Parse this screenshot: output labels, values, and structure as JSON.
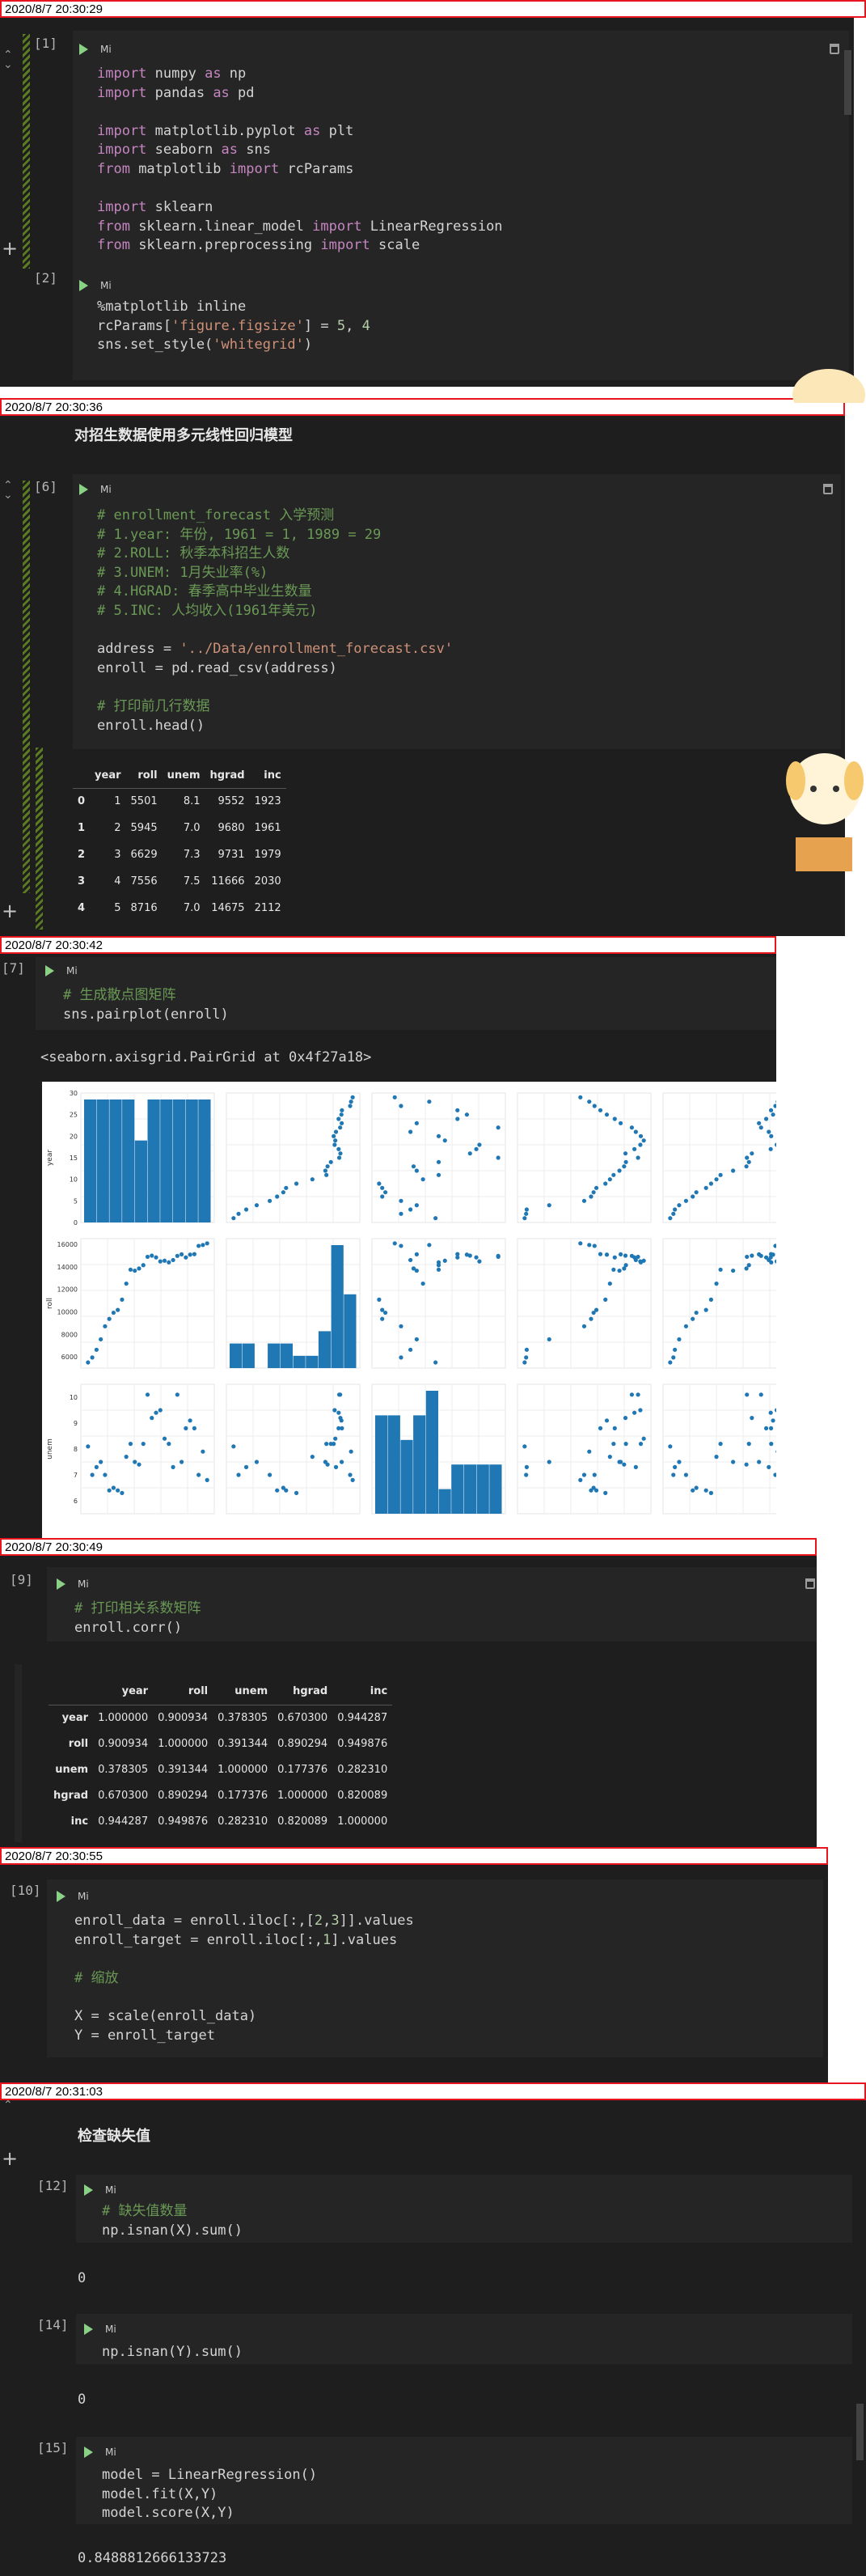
{
  "sections": [
    {
      "timestamp": "2020/8/7 20:30:29"
    },
    {
      "timestamp": "2020/8/7 20:30:36"
    },
    {
      "timestamp": "2020/8/7 20:30:42"
    },
    {
      "timestamp": "2020/8/7 20:30:49"
    },
    {
      "timestamp": "2020/8/7 20:30:55"
    },
    {
      "timestamp": "2020/8/7 20:31:03"
    }
  ],
  "run_label": "Mi",
  "cells": {
    "c1": {
      "num": "[1]",
      "lines": [
        "import numpy as np",
        "import pandas as pd",
        "",
        "import matplotlib.pyplot as plt",
        "import seaborn as sns",
        "from matplotlib import rcParams",
        "",
        "import sklearn",
        "from sklearn.linear_model import LinearRegression",
        "from sklearn.preprocessing import scale"
      ]
    },
    "c2": {
      "num": "[2]",
      "lines": [
        "%matplotlib inline",
        "rcParams['figure.figsize'] = 5, 4",
        "sns.set_style('whitegrid')"
      ]
    },
    "md1": "对招生数据使用多元线性回归模型",
    "c6": {
      "num": "[6]",
      "lines": [
        "# enrollment_forecast 入学预测",
        "# 1.year: 年份, 1961 = 1, 1989 = 29",
        "# 2.ROLL: 秋季本科招生人数",
        "# 3.UNEM: 1月失业率(%)",
        "# 4.HGRAD: 春季高中毕业生数量",
        "# 5.INC: 人均收入(1961年美元)",
        "",
        "address = '../Data/enrollment_forecast.csv'",
        "enroll = pd.read_csv(address)",
        "",
        "# 打印前几行数据",
        "enroll.head()"
      ]
    },
    "head_table": {
      "columns": [
        "",
        "year",
        "roll",
        "unem",
        "hgrad",
        "inc"
      ],
      "rows": [
        [
          "0",
          "1",
          "5501",
          "8.1",
          "9552",
          "1923"
        ],
        [
          "1",
          "2",
          "5945",
          "7.0",
          "9680",
          "1961"
        ],
        [
          "2",
          "3",
          "6629",
          "7.3",
          "9731",
          "1979"
        ],
        [
          "3",
          "4",
          "7556",
          "7.5",
          "11666",
          "2030"
        ],
        [
          "4",
          "5",
          "8716",
          "7.0",
          "14675",
          "2112"
        ]
      ]
    },
    "c7": {
      "num": "[7]",
      "lines": [
        "# 生成散点图矩阵",
        "sns.pairplot(enroll)"
      ],
      "output": "<seaborn.axisgrid.PairGrid at 0x4f27a18>"
    },
    "c9": {
      "num": "[9]",
      "lines": [
        "# 打印相关系数矩阵",
        "enroll.corr()"
      ]
    },
    "corr_table": {
      "columns": [
        "",
        "year",
        "roll",
        "unem",
        "hgrad",
        "inc"
      ],
      "rows": [
        [
          "year",
          "1.000000",
          "0.900934",
          "0.378305",
          "0.670300",
          "0.944287"
        ],
        [
          "roll",
          "0.900934",
          "1.000000",
          "0.391344",
          "0.890294",
          "0.949876"
        ],
        [
          "unem",
          "0.378305",
          "0.391344",
          "1.000000",
          "0.177376",
          "0.282310"
        ],
        [
          "hgrad",
          "0.670300",
          "0.890294",
          "0.177376",
          "1.000000",
          "0.820089"
        ],
        [
          "inc",
          "0.944287",
          "0.949876",
          "0.282310",
          "0.820089",
          "1.000000"
        ]
      ]
    },
    "c10": {
      "num": "[10]",
      "lines": [
        "enroll_data = enroll.iloc[:,[2,3]].values",
        "enroll_target = enroll.iloc[:,1].values",
        "",
        "# 缩放",
        "",
        "X = scale(enroll_data)",
        "Y = enroll_target"
      ]
    },
    "md2": "检查缺失值",
    "c12": {
      "num": "[12]",
      "lines": [
        "# 缺失值数量",
        "np.isnan(X).sum()"
      ],
      "output": "0"
    },
    "c14": {
      "num": "[14]",
      "lines": [
        "np.isnan(Y).sum()"
      ],
      "output": "0"
    },
    "c15": {
      "num": "[15]",
      "lines": [
        "model = LinearRegression()",
        "model.fit(X,Y)",
        "model.score(X,Y)"
      ],
      "output": "0.8488812666133723"
    }
  },
  "chart_data": {
    "type": "scatter",
    "title": "",
    "variables": [
      "year",
      "roll",
      "unem",
      "hgrad",
      "inc"
    ],
    "visible_rows": [
      "year",
      "roll",
      "unem"
    ],
    "ylabels": [
      "year",
      "roll",
      "unem"
    ],
    "yticks": {
      "year": [
        "0",
        "5",
        "10",
        "15",
        "20",
        "25",
        "30"
      ],
      "roll": [
        "6000",
        "8000",
        "10000",
        "12000",
        "14000",
        "16000"
      ],
      "unem": [
        "6",
        "7",
        "8",
        "9",
        "10"
      ]
    },
    "data": {
      "year": [
        1,
        2,
        3,
        4,
        5,
        6,
        7,
        8,
        9,
        10,
        11,
        12,
        13,
        14,
        15,
        16,
        17,
        18,
        19,
        20,
        21,
        22,
        23,
        24,
        25,
        26,
        27,
        28,
        29
      ],
      "roll": [
        5501,
        5945,
        6629,
        7556,
        8716,
        9369,
        9920,
        10167,
        11084,
        12504,
        13746,
        13656,
        13850,
        14145,
        14888,
        14991,
        14836,
        14478,
        14539,
        14395,
        14599,
        14969,
        15107,
        14831,
        15081,
        15127,
        15856,
        15938,
        16081
      ],
      "unem": [
        8.1,
        7.0,
        7.3,
        7.5,
        7.0,
        6.4,
        6.5,
        6.4,
        6.3,
        7.7,
        8.2,
        7.5,
        7.4,
        8.2,
        10.1,
        9.2,
        9.4,
        9.5,
        8.4,
        8.2,
        7.3,
        10.1,
        7.5,
        8.8,
        9.1,
        8.8,
        7.0,
        7.9,
        6.8
      ],
      "hgrad": [
        9552,
        9680,
        9731,
        11666,
        14675,
        15265,
        15484,
        15723,
        16501,
        16890,
        17203,
        17707,
        18108,
        18266,
        19308,
        18224,
        18997,
        19505,
        19800,
        19546,
        19117,
        18774,
        17813,
        17304,
        16623,
        16068,
        15564,
        15112,
        14348
      ],
      "inc": [
        1923,
        1961,
        1979,
        2030,
        2112,
        2192,
        2235,
        2351,
        2411,
        2475,
        2524,
        2674,
        2833,
        2863,
        2839,
        2898,
        3123,
        3195,
        3239,
        3129,
        3100,
        3008,
        2983,
        3069,
        3151,
        3127,
        3179,
        3207,
        3345
      ]
    },
    "grid": true,
    "color": "#1f77b4"
  }
}
